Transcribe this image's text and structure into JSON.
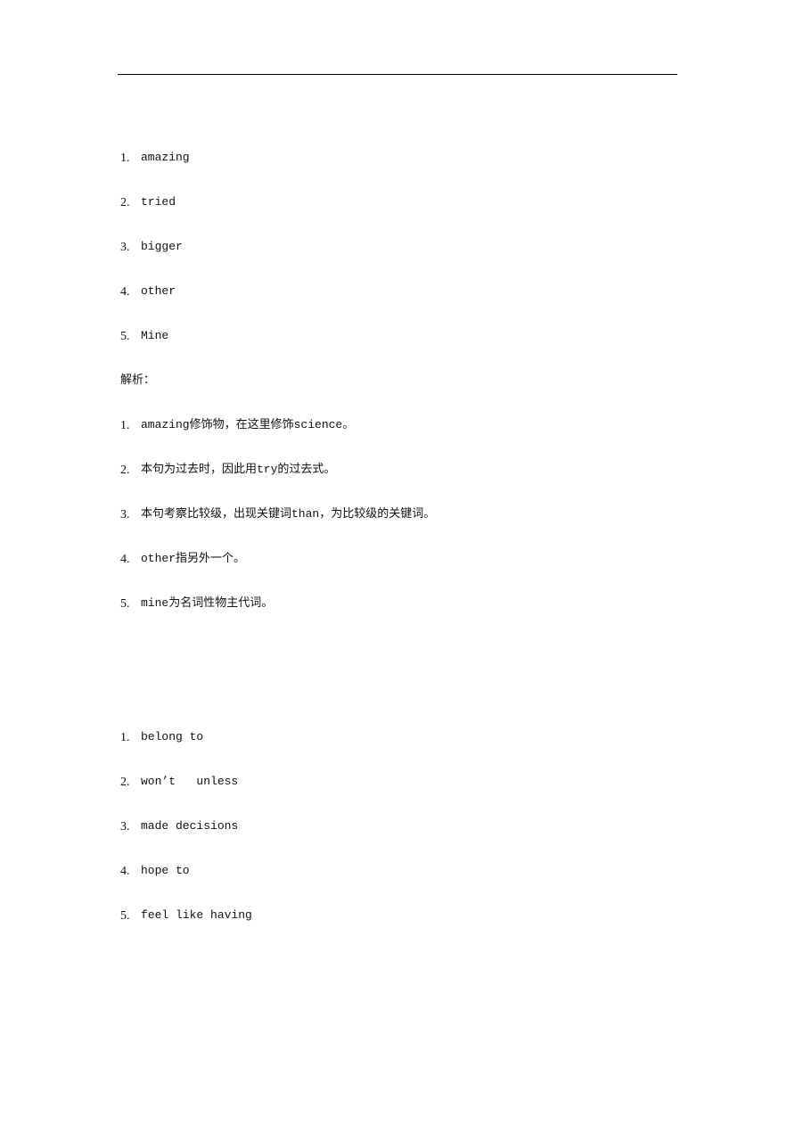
{
  "answers_1": [
    {
      "num": "1.",
      "text": "amazing"
    },
    {
      "num": "2.",
      "text": "tried"
    },
    {
      "num": "3.",
      "text": "bigger"
    },
    {
      "num": "4.",
      "text": "other"
    },
    {
      "num": "5.",
      "text": "Mine"
    }
  ],
  "analysis_heading": "解析：",
  "analysis": [
    {
      "num": "1.",
      "text": "amazing修饰物，在这里修饰science。"
    },
    {
      "num": "2.",
      "text": "本句为过去时，因此用try的过去式。"
    },
    {
      "num": "3.",
      "text": "本句考察比较级，出现关键词than，为比较级的关键词。"
    },
    {
      "num": "4.",
      "text": "other指另外一个。"
    },
    {
      "num": "5.",
      "text": "mine为名词性物主代词。"
    }
  ],
  "answers_2": [
    {
      "num": "1.",
      "text": "belong to"
    },
    {
      "num": "2.",
      "text": "won’t   unless"
    },
    {
      "num": "3.",
      "text": "made decisions"
    },
    {
      "num": "4.",
      "text": "hope to"
    },
    {
      "num": "5.",
      "text": "feel like having"
    }
  ]
}
